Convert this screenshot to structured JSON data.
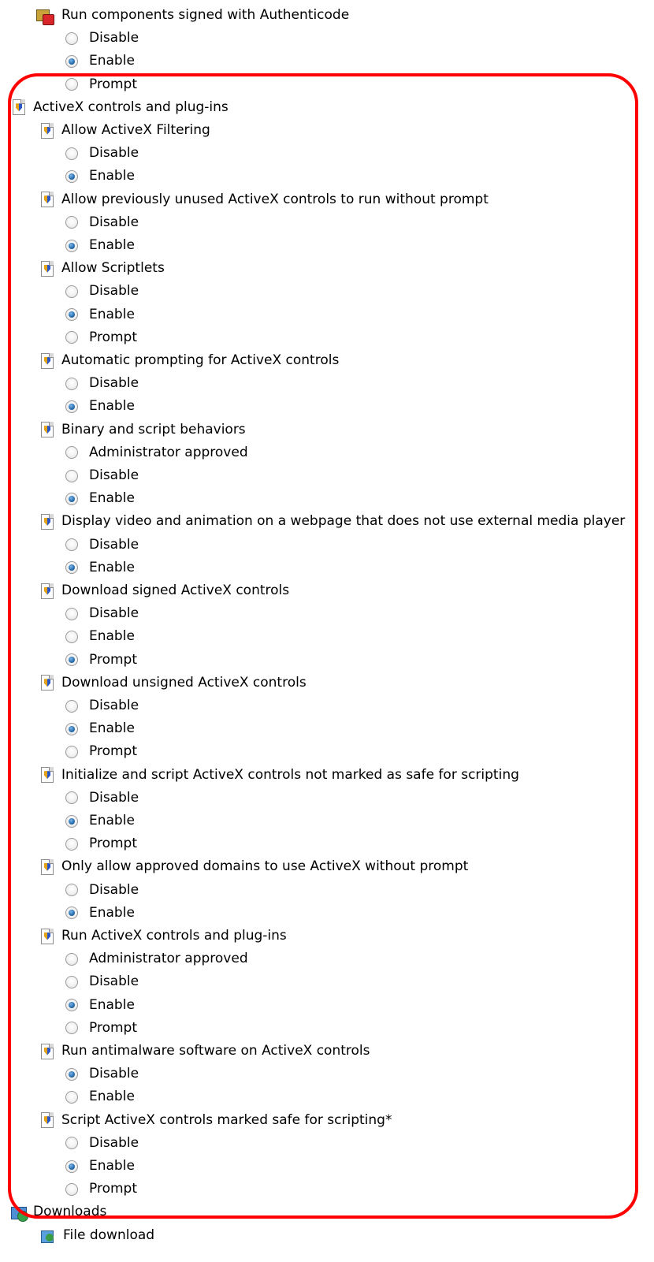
{
  "tree": {
    "top_setting": {
      "label": "Run components signed with Authenticode",
      "icon": "authenticode-icon",
      "options": [
        {
          "label": "Disable",
          "selected": false
        },
        {
          "label": "Enable",
          "selected": true
        },
        {
          "label": "Prompt",
          "selected": false
        }
      ]
    },
    "group": {
      "label": "ActiveX controls and plug-ins",
      "icon": "policy-document-icon",
      "settings": [
        {
          "label": "Allow ActiveX Filtering",
          "options": [
            {
              "label": "Disable",
              "selected": false
            },
            {
              "label": "Enable",
              "selected": true
            }
          ]
        },
        {
          "label": "Allow previously unused ActiveX controls to run without prompt",
          "options": [
            {
              "label": "Disable",
              "selected": false
            },
            {
              "label": "Enable",
              "selected": true
            }
          ]
        },
        {
          "label": "Allow Scriptlets",
          "options": [
            {
              "label": "Disable",
              "selected": false
            },
            {
              "label": "Enable",
              "selected": true
            },
            {
              "label": "Prompt",
              "selected": false
            }
          ]
        },
        {
          "label": "Automatic prompting for ActiveX controls",
          "options": [
            {
              "label": "Disable",
              "selected": false
            },
            {
              "label": "Enable",
              "selected": true
            }
          ]
        },
        {
          "label": "Binary and script behaviors",
          "options": [
            {
              "label": "Administrator approved",
              "selected": false
            },
            {
              "label": "Disable",
              "selected": false
            },
            {
              "label": "Enable",
              "selected": true
            }
          ]
        },
        {
          "label": "Display video and animation on a webpage that does not use external media player",
          "options": [
            {
              "label": "Disable",
              "selected": false
            },
            {
              "label": "Enable",
              "selected": true
            }
          ]
        },
        {
          "label": "Download signed ActiveX controls",
          "options": [
            {
              "label": "Disable",
              "selected": false
            },
            {
              "label": "Enable",
              "selected": false
            },
            {
              "label": "Prompt",
              "selected": true
            }
          ]
        },
        {
          "label": "Download unsigned ActiveX controls",
          "options": [
            {
              "label": "Disable",
              "selected": false
            },
            {
              "label": "Enable",
              "selected": true
            },
            {
              "label": "Prompt",
              "selected": false
            }
          ]
        },
        {
          "label": "Initialize and script ActiveX controls not marked as safe for scripting",
          "options": [
            {
              "label": "Disable",
              "selected": false
            },
            {
              "label": "Enable",
              "selected": true
            },
            {
              "label": "Prompt",
              "selected": false
            }
          ]
        },
        {
          "label": "Only allow approved domains to use ActiveX without prompt",
          "options": [
            {
              "label": "Disable",
              "selected": false
            },
            {
              "label": "Enable",
              "selected": true
            }
          ]
        },
        {
          "label": "Run ActiveX controls and plug-ins",
          "options": [
            {
              "label": "Administrator approved",
              "selected": false
            },
            {
              "label": "Disable",
              "selected": false
            },
            {
              "label": "Enable",
              "selected": true
            },
            {
              "label": "Prompt",
              "selected": false
            }
          ]
        },
        {
          "label": "Run antimalware software on ActiveX controls",
          "options": [
            {
              "label": "Disable",
              "selected": true
            },
            {
              "label": "Enable",
              "selected": false
            }
          ]
        },
        {
          "label": "Script ActiveX controls marked safe for scripting*",
          "options": [
            {
              "label": "Disable",
              "selected": false
            },
            {
              "label": "Enable",
              "selected": true
            },
            {
              "label": "Prompt",
              "selected": false
            }
          ]
        }
      ]
    },
    "downloads": {
      "label": "Downloads",
      "icon": "downloads-folder-icon"
    },
    "file_download": {
      "label": "File download",
      "icon": "file-download-icon"
    }
  },
  "highlight_color": "#ff0000"
}
